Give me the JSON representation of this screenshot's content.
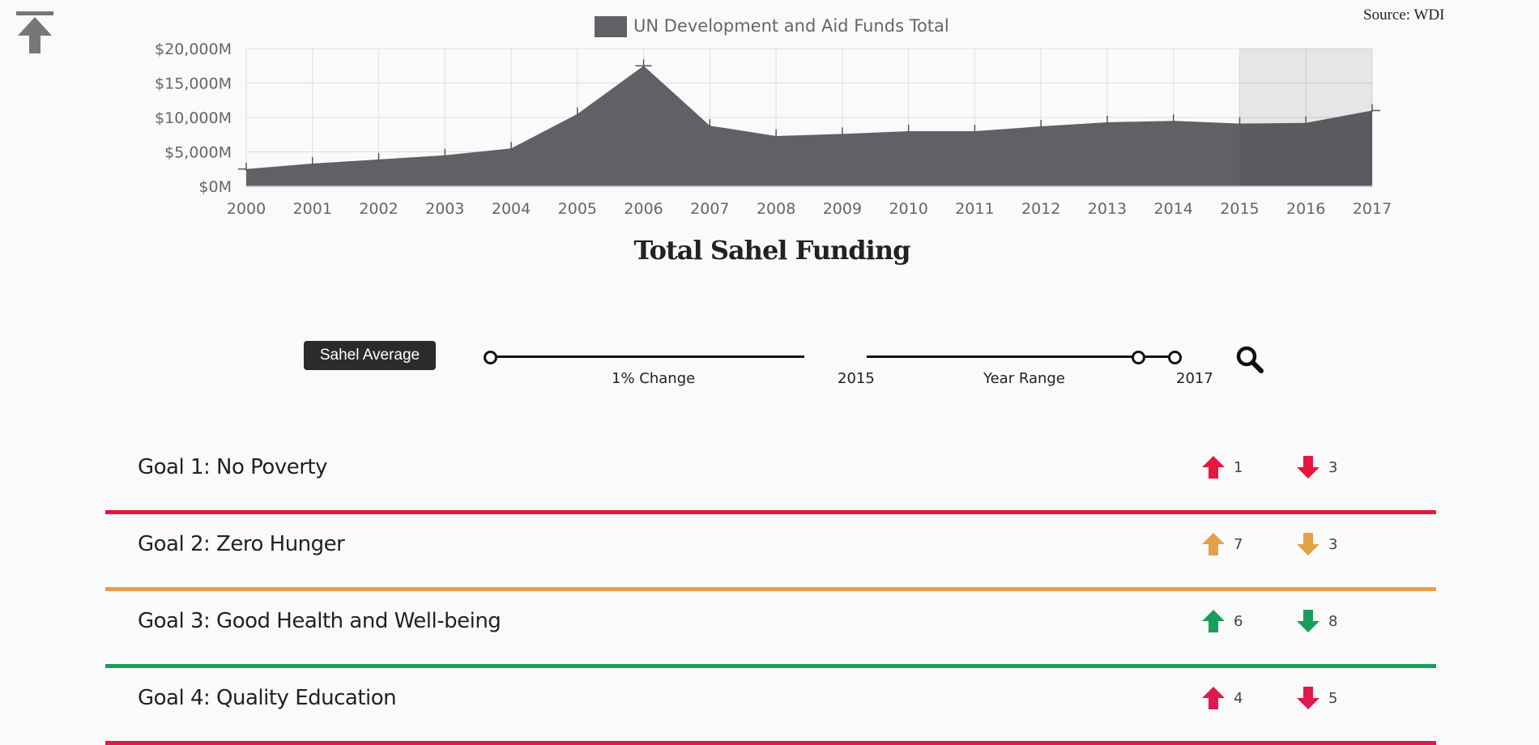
{
  "source_label": "Source: WDI",
  "chart_data": {
    "type": "area",
    "title": "Total Sahel Funding",
    "legend": "UN Development and Aid Funds Total",
    "legend_position": "top-center",
    "color": "#5f6166",
    "x": [
      "2000",
      "2001",
      "2002",
      "2003",
      "2004",
      "2005",
      "2006",
      "2007",
      "2008",
      "2009",
      "2010",
      "2011",
      "2012",
      "2013",
      "2014",
      "2015",
      "2016",
      "2017"
    ],
    "values": [
      2500,
      3300,
      3900,
      4500,
      5500,
      10500,
      17500,
      8800,
      7300,
      7600,
      8000,
      8000,
      8700,
      9300,
      9500,
      9100,
      9200,
      11000
    ],
    "y_ticks": [
      "$0M",
      "$5,000M",
      "$10,000M",
      "$15,000M",
      "$20,000M"
    ],
    "ylim": [
      0,
      20000
    ],
    "grid": true,
    "highlight_range": [
      "2015",
      "2017"
    ]
  },
  "controls": {
    "average_button": "Sahel Average",
    "change_label": "1% Change",
    "year_start": "2015",
    "range_label": "Year Range",
    "year_end": "2017"
  },
  "goals": [
    {
      "title": "Goal 1: No Poverty",
      "up": "1",
      "down": "3",
      "color": "#e5173f"
    },
    {
      "title": "Goal 2: Zero Hunger",
      "up": "7",
      "down": "3",
      "color": "#e5a04a"
    },
    {
      "title": "Goal 3: Good Health and Well-being",
      "up": "6",
      "down": "8",
      "color": "#1a9e5c"
    },
    {
      "title": "Goal 4: Quality Education",
      "up": "4",
      "down": "5",
      "color": "#e0184d"
    }
  ]
}
